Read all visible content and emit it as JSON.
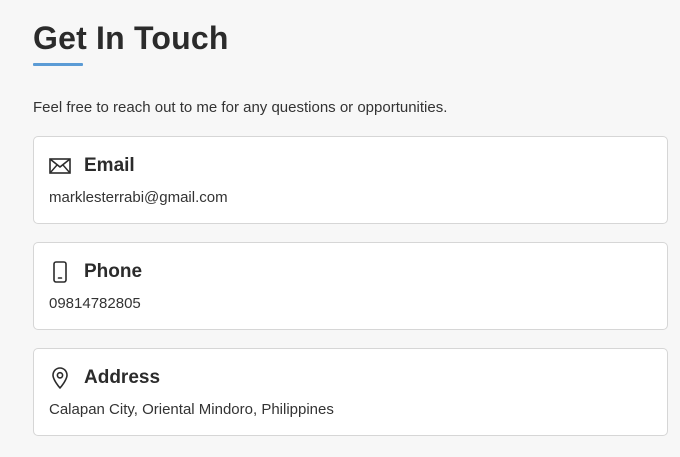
{
  "section": {
    "title": "Get In Touch",
    "intro": "Feel free to reach out to me for any questions or opportunities."
  },
  "contacts": [
    {
      "icon": "envelope-icon",
      "label": "Email",
      "value": "marklesterrabi@gmail.com"
    },
    {
      "icon": "phone-icon",
      "label": "Phone",
      "value": "09814782805"
    },
    {
      "icon": "location-pin-icon",
      "label": "Address",
      "value": "Calapan City, Oriental Mindoro, Philippines"
    }
  ],
  "colors": {
    "accent": "#5b9bd5",
    "background": "#f7f7f7",
    "card_border": "#d6d6d6",
    "text": "#2b2b2b"
  }
}
